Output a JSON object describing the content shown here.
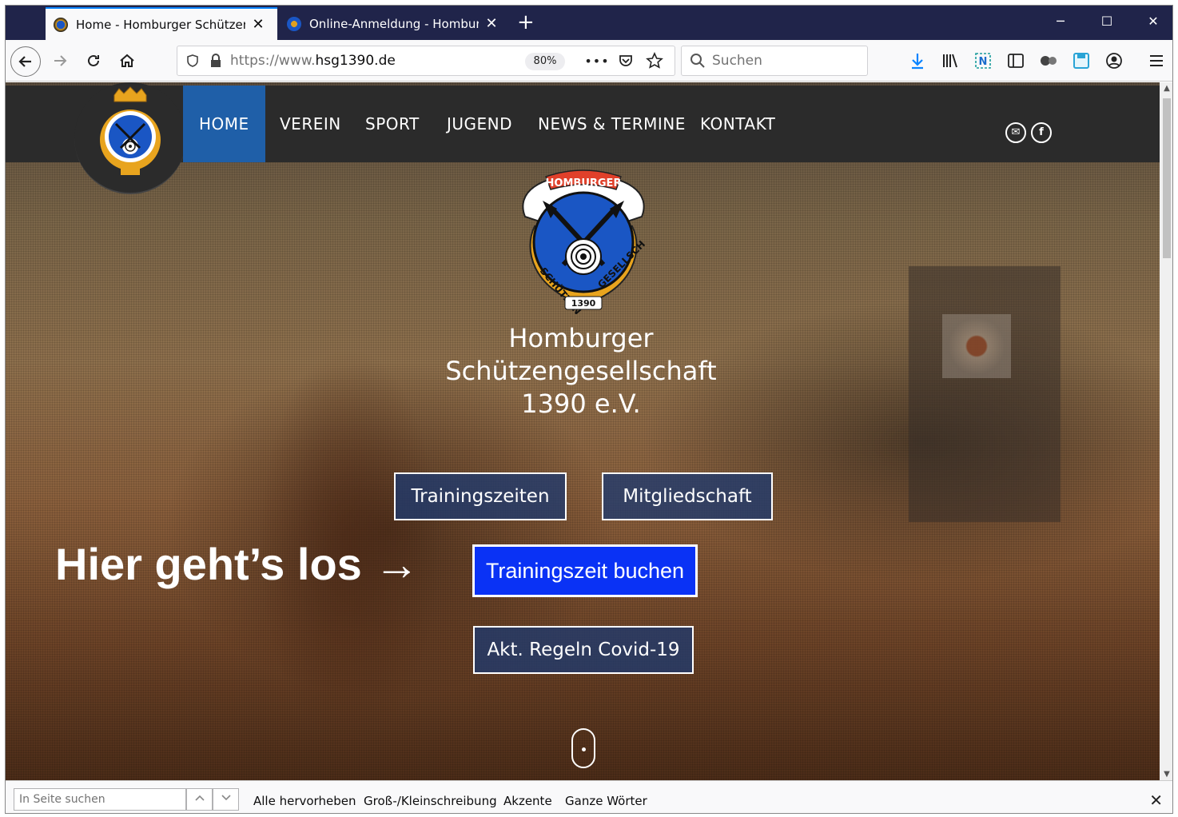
{
  "browser": {
    "tabs": [
      {
        "title": "Home - Homburger Schützengesellschaft",
        "close": "✕"
      },
      {
        "title": "Online-Anmeldung - Homburger",
        "close": "✕"
      }
    ],
    "newtab": "+",
    "window_controls": {
      "minimize": "─",
      "maximize": "☐",
      "close": "✕"
    },
    "url_protocol": "https://www.",
    "url_host": "hsg1390.de",
    "zoom": "80%",
    "page_actions": "•••",
    "search_placeholder": "Suchen"
  },
  "site": {
    "nav": [
      "HOME",
      "VEREIN",
      "SPORT",
      "JUGEND",
      "NEWS & TERMINE",
      "KONTAKT"
    ],
    "social": {
      "mail": "✉",
      "facebook": "f"
    },
    "logo_text_top": "HOMBURGER",
    "logo_text_left": "SCHÜTZEN",
    "logo_text_right": "GESELLSCH",
    "logo_year": "1390",
    "hero_title_line1": "Homburger",
    "hero_title_line2": "Schützengesellschaft",
    "hero_title_line3": "1390 e.V.",
    "btn_training": "Trainingszeiten",
    "btn_membership": "Mitgliedschaft",
    "cta_text": "Hier geht’s los →",
    "btn_book": "Trainingszeit buchen",
    "btn_covid": "Akt. Regeln Covid-19"
  },
  "findbar": {
    "placeholder": "In Seite suchen",
    "highlight_all": "Alle hervorheben",
    "match_case": "Groß-/Kleinschreibung",
    "accents": "Akzente",
    "whole_words": "Ganze Wörter"
  },
  "colors": {
    "titlebar": "#20244a",
    "site_blue": "#1f5fa8",
    "book_blue": "#0a32f5"
  }
}
